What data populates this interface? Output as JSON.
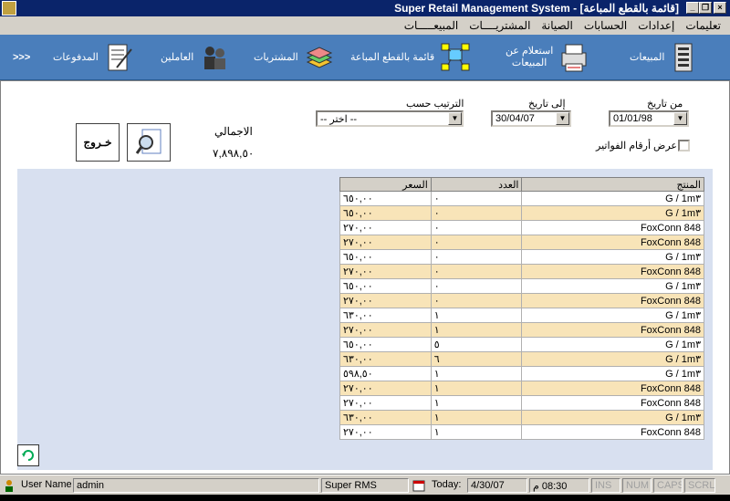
{
  "window": {
    "title": "Super Retail Management System - [قائمة بالقطع المباعة]",
    "icon": "app-icon"
  },
  "menu": [
    "المبيعـــــات",
    "المشتريــــات",
    "الصيانة",
    "الحسابات",
    "إعدادات",
    "تعليمات"
  ],
  "toolbar": {
    "sales": "المبيعات",
    "query_sales_1": "استعلام عن",
    "query_sales_2": "المبيعات",
    "sold_parts": "قائمة بالقطع المباعة",
    "purchases": "المشتريات",
    "workers": "العاملين",
    "payments": "المدفوعات",
    "more": ">>>"
  },
  "filters": {
    "from_label": "من تاريخ",
    "from_value": "01/01/98",
    "to_label": "إلى تاريخ",
    "to_value": "30/04/07",
    "sort_label": "الترتيب حسب",
    "sort_value": "-- اختر --",
    "show_invoices_label": "عرض أرقام الفواتير",
    "total_label": "الاجمالي",
    "total_value": "٧,٨٩٨,٥٠"
  },
  "buttons": {
    "exit": "خـروج"
  },
  "grid": {
    "headers": {
      "product": "المنتج",
      "qty": "العدد",
      "price": "السعر"
    },
    "rows": [
      {
        "product": "G / 1m٣",
        "qty": "٠",
        "price": "٦٥٠,٠٠"
      },
      {
        "product": "G / 1m٣",
        "qty": "٠",
        "price": "٦٥٠,٠٠"
      },
      {
        "product": "FoxConn 848",
        "qty": "٠",
        "price": "٢٧٠,٠٠"
      },
      {
        "product": "FoxConn 848",
        "qty": "٠",
        "price": "٢٧٠,٠٠"
      },
      {
        "product": "G / 1m٣",
        "qty": "٠",
        "price": "٦٥٠,٠٠"
      },
      {
        "product": "FoxConn 848",
        "qty": "٠",
        "price": "٢٧٠,٠٠"
      },
      {
        "product": "G / 1m٣",
        "qty": "٠",
        "price": "٦٥٠,٠٠"
      },
      {
        "product": "FoxConn 848",
        "qty": "٠",
        "price": "٢٧٠,٠٠"
      },
      {
        "product": "G / 1m٣",
        "qty": "١",
        "price": "٦٣٠,٠٠"
      },
      {
        "product": "FoxConn 848",
        "qty": "١",
        "price": "٢٧٠,٠٠"
      },
      {
        "product": "G / 1m٣",
        "qty": "٥",
        "price": "٦٥٠,٠٠"
      },
      {
        "product": "G / 1m٣",
        "qty": "٦",
        "price": "٦٣٠,٠٠"
      },
      {
        "product": "G / 1m٣",
        "qty": "١",
        "price": "٥٩٨,٥٠"
      },
      {
        "product": "FoxConn 848",
        "qty": "١",
        "price": "٢٧٠,٠٠"
      },
      {
        "product": "FoxConn 848",
        "qty": "١",
        "price": "٢٧٠,٠٠"
      },
      {
        "product": "G / 1m٣",
        "qty": "١",
        "price": "٦٣٠,٠٠"
      },
      {
        "product": "FoxConn 848",
        "qty": "١",
        "price": "٢٧٠,٠٠"
      }
    ]
  },
  "status": {
    "user": "User Name:",
    "user_value": "admin",
    "app": "Super RMS",
    "today_label": "Today:",
    "today_value": "4/30/07",
    "time": "08:30 م",
    "ins": "INS",
    "num": "NUM",
    "caps": "CAPS",
    "scrl": "SCRL"
  },
  "colors": {
    "titlebar": "#0a246a",
    "toolbar": "#4a7ebb",
    "row_alt": "#f8e4b8",
    "panel": "#d8e0f0"
  }
}
